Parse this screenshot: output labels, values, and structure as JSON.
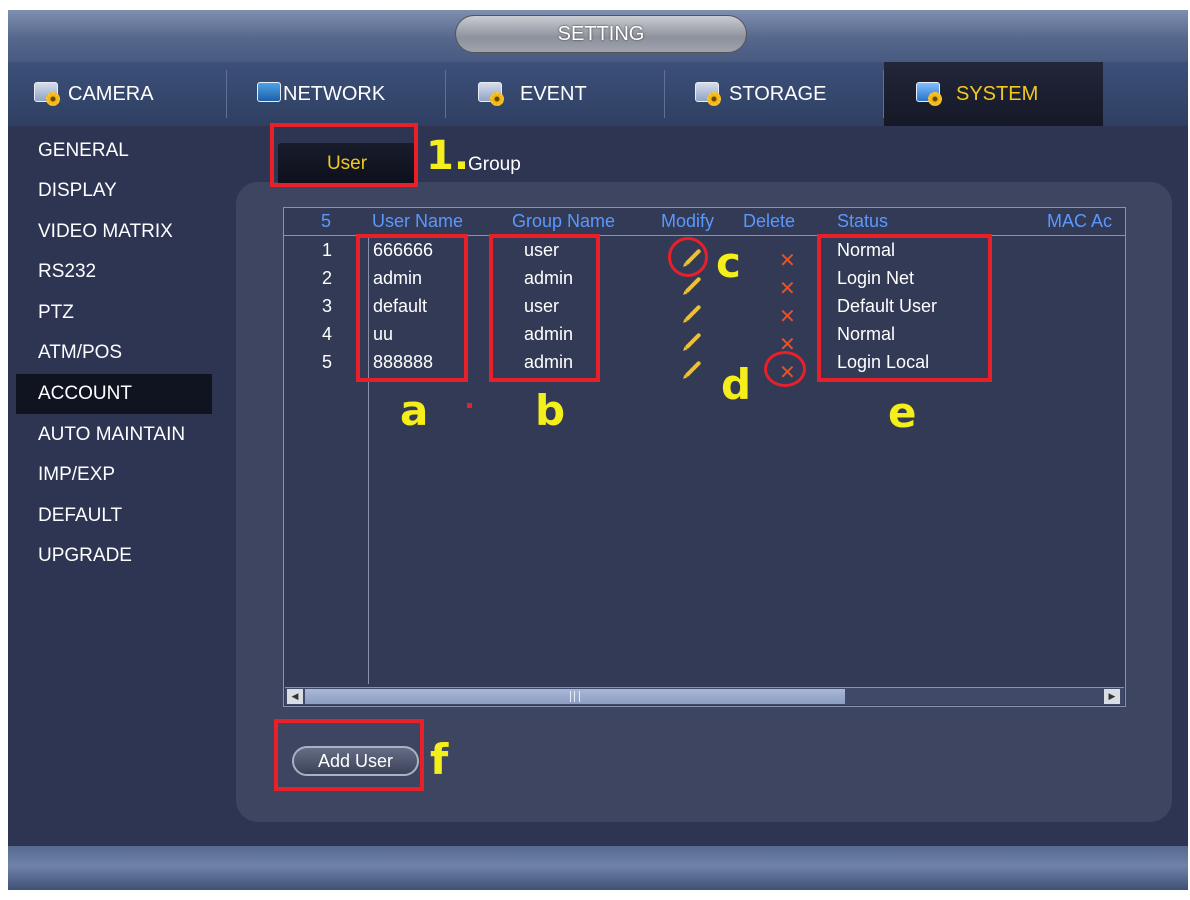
{
  "window_title": "SETTING",
  "tabs": [
    {
      "label": "CAMERA",
      "icon": "camera-settings-icon"
    },
    {
      "label": "NETWORK",
      "icon": "network-settings-icon"
    },
    {
      "label": "EVENT",
      "icon": "event-settings-icon"
    },
    {
      "label": "STORAGE",
      "icon": "storage-settings-icon"
    },
    {
      "label": "SYSTEM",
      "icon": "system-settings-icon",
      "active": true
    }
  ],
  "sidebar": {
    "items": [
      {
        "label": "GENERAL"
      },
      {
        "label": "DISPLAY"
      },
      {
        "label": "VIDEO MATRIX"
      },
      {
        "label": "RS232"
      },
      {
        "label": "PTZ"
      },
      {
        "label": "ATM/POS"
      },
      {
        "label": "ACCOUNT",
        "active": true
      },
      {
        "label": "AUTO MAINTAIN"
      },
      {
        "label": "IMP/EXP"
      },
      {
        "label": "DEFAULT"
      },
      {
        "label": "UPGRADE"
      }
    ]
  },
  "subtabs": {
    "user": "User",
    "group": "Group"
  },
  "table": {
    "headers": {
      "count": "5",
      "user_name": "User Name",
      "group_name": "Group Name",
      "modify": "Modify",
      "delete": "Delete",
      "status": "Status",
      "mac": "MAC Ac"
    },
    "rows": [
      {
        "no": "1",
        "user": "666666",
        "group": "user",
        "status": "Normal"
      },
      {
        "no": "2",
        "user": "admin",
        "group": "admin",
        "status": "Login Net"
      },
      {
        "no": "3",
        "user": "default",
        "group": "user",
        "status": "Default User"
      },
      {
        "no": "4",
        "user": "uu",
        "group": "admin",
        "status": "Normal"
      },
      {
        "no": "5",
        "user": "888888",
        "group": "admin",
        "status": "Login Local"
      }
    ]
  },
  "buttons": {
    "add_user": "Add User"
  },
  "annotations": {
    "step": "1.",
    "a": "a",
    "b": "b",
    "c": "c",
    "d": "d",
    "e": "e",
    "f": "f",
    "color_box": "#e8202a",
    "color_label": "#f4ef1b"
  },
  "colors": {
    "active_tab_text": "#f2c822",
    "header_text": "#5a98ff",
    "delete_x": "#f05020"
  }
}
